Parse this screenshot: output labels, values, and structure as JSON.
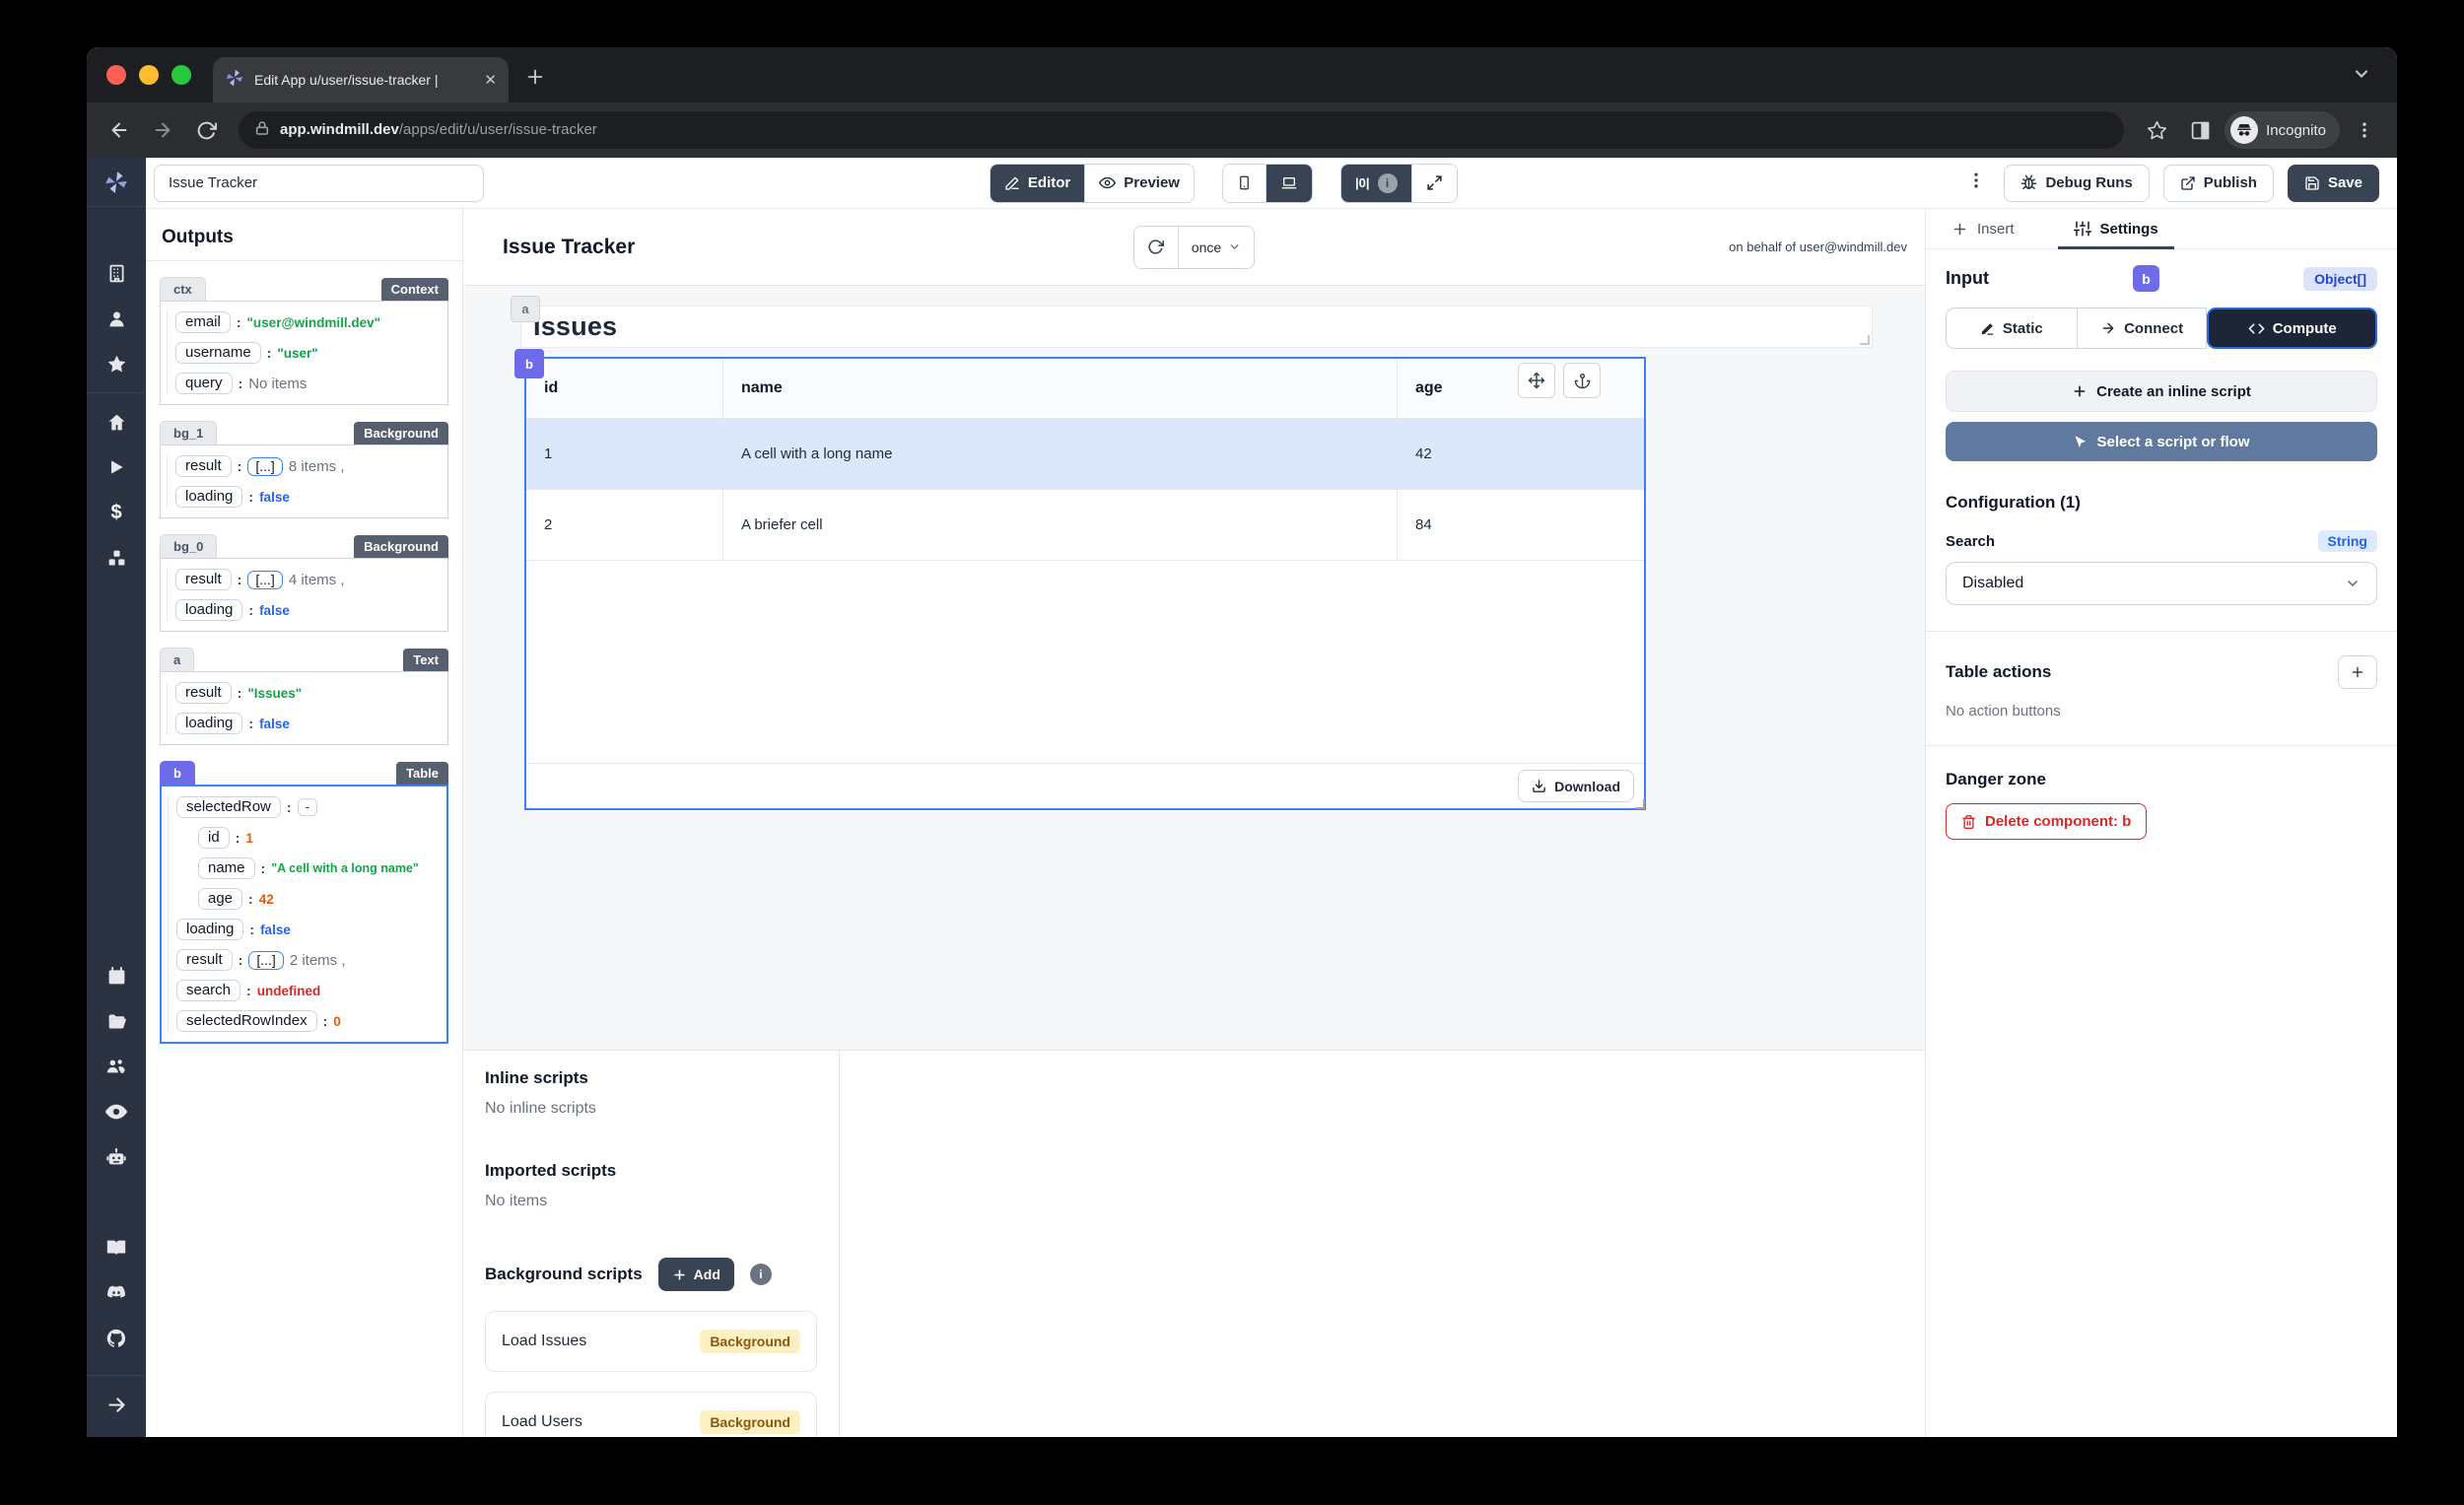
{
  "browser": {
    "tab_title": "Edit App u/user/issue-tracker |",
    "url_host": "app.windmill.dev",
    "url_path": "/apps/edit/u/user/issue-tracker",
    "incognito_label": "Incognito"
  },
  "toolbar": {
    "app_name_value": "Issue Tracker",
    "editor": "Editor",
    "preview": "Preview",
    "zero_toggle": "|0|",
    "debug_runs": "Debug Runs",
    "publish": "Publish",
    "save": "Save"
  },
  "outputs": {
    "title": "Outputs",
    "sections": [
      {
        "id": "ctx",
        "badge": "Context",
        "rows": [
          {
            "key": "email",
            "value": "\"user@windmill.dev\""
          },
          {
            "key": "username",
            "value": "\"user\""
          },
          {
            "key": "query",
            "value": "No items"
          }
        ]
      },
      {
        "id": "bg_1",
        "badge": "Background",
        "rows": [
          {
            "key": "result",
            "bracket": "[...]",
            "value": "8 items ,"
          },
          {
            "key": "loading",
            "value": "false"
          }
        ]
      },
      {
        "id": "bg_0",
        "badge": "Background",
        "rows": [
          {
            "key": "result",
            "bracket": "[...]",
            "value": "4 items ,"
          },
          {
            "key": "loading",
            "value": "false"
          }
        ]
      },
      {
        "id": "a",
        "badge": "Text",
        "rows": [
          {
            "key": "result",
            "value": "\"Issues\""
          },
          {
            "key": "loading",
            "value": "false"
          }
        ]
      },
      {
        "id": "b",
        "badge": "Table",
        "rows": [
          {
            "key": "selectedRow",
            "value": "-"
          },
          {
            "key": "id",
            "value": "1"
          },
          {
            "key": "name",
            "value": "\"A cell with a long name\""
          },
          {
            "key": "age",
            "value": "42"
          },
          {
            "key": "loading",
            "value": "false"
          },
          {
            "key": "result",
            "bracket": "[...]",
            "value": "2 items ,"
          },
          {
            "key": "search",
            "value": "undefined"
          },
          {
            "key": "selectedRowIndex",
            "value": "0"
          }
        ]
      }
    ]
  },
  "canvas": {
    "title": "Issue Tracker",
    "refresh_mode": "once",
    "on_behalf": "on behalf of user@windmill.dev",
    "text_component": {
      "label": "a",
      "text": "Issues"
    },
    "table_component": {
      "label": "b",
      "columns": [
        "id",
        "name",
        "age"
      ],
      "rows": [
        [
          "1",
          "A cell with a long name",
          "42"
        ],
        [
          "2",
          "A briefer cell",
          "84"
        ]
      ],
      "download": "Download"
    }
  },
  "scripts_panel": {
    "inline_title": "Inline scripts",
    "inline_empty": "No inline scripts",
    "imported_title": "Imported scripts",
    "imported_empty": "No items",
    "background_title": "Background scripts",
    "add_label": "Add",
    "items": [
      {
        "name": "Load Issues",
        "badge": "Background"
      },
      {
        "name": "Load Users",
        "badge": "Background"
      }
    ]
  },
  "settings": {
    "tab_insert": "Insert",
    "tab_settings": "Settings",
    "input_label": "Input",
    "component_id": "b",
    "type_badge": "Object[]",
    "static_label": "Static",
    "connect_label": "Connect",
    "compute_label": "Compute",
    "create_inline": "Create an inline script",
    "select_script": "Select a script or flow",
    "configuration": "Configuration (1)",
    "search_label": "Search",
    "string_badge": "String",
    "search_value": "Disabled",
    "table_actions": "Table actions",
    "no_actions": "No action buttons",
    "danger": "Danger zone",
    "delete_component": "Delete component: b"
  },
  "colors": {
    "accent": "#3b82f6",
    "component": "#6e6be8",
    "danger": "#dc2626"
  }
}
